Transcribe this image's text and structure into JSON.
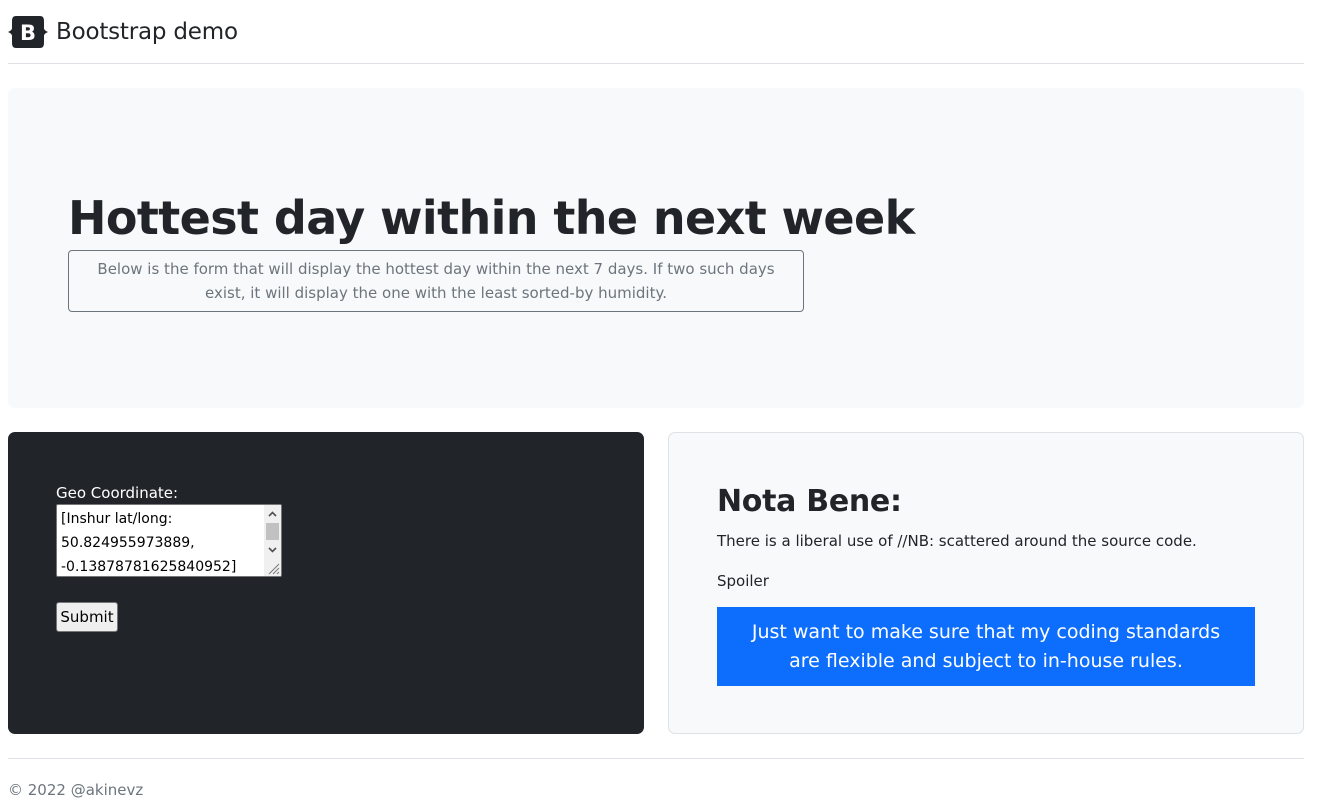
{
  "header": {
    "brand_text": "Bootstrap demo",
    "logo_icon": "bootstrap-logo-icon",
    "logo_letter": "B"
  },
  "hero": {
    "title": "Hottest day within the next week",
    "description": "Below is the form that will display the hottest day within the next 7 days. If two such days exist, it will display the one with the least sorted-by humidity."
  },
  "form": {
    "geo_label": "Geo Coordinate:",
    "geo_value": "[Inshur lat/long:\n50.824955973889,\n-0.13878781625840952]",
    "submit_label": "Submit"
  },
  "nota_bene": {
    "title": "Nota Bene:",
    "text": "There is a liberal use of //NB: scattered around the source code.",
    "spoiler_label": "Spoiler",
    "spoiler_text": "Just want to make sure that my coding standards are flexible and subject to in-house rules."
  },
  "footer": {
    "copyright": "© 2022 @akinevz"
  },
  "colors": {
    "primary": "#0d6efd",
    "dark": "#212529",
    "light": "#f8f9fa",
    "muted": "#6c757d",
    "border": "#dee2e6"
  }
}
